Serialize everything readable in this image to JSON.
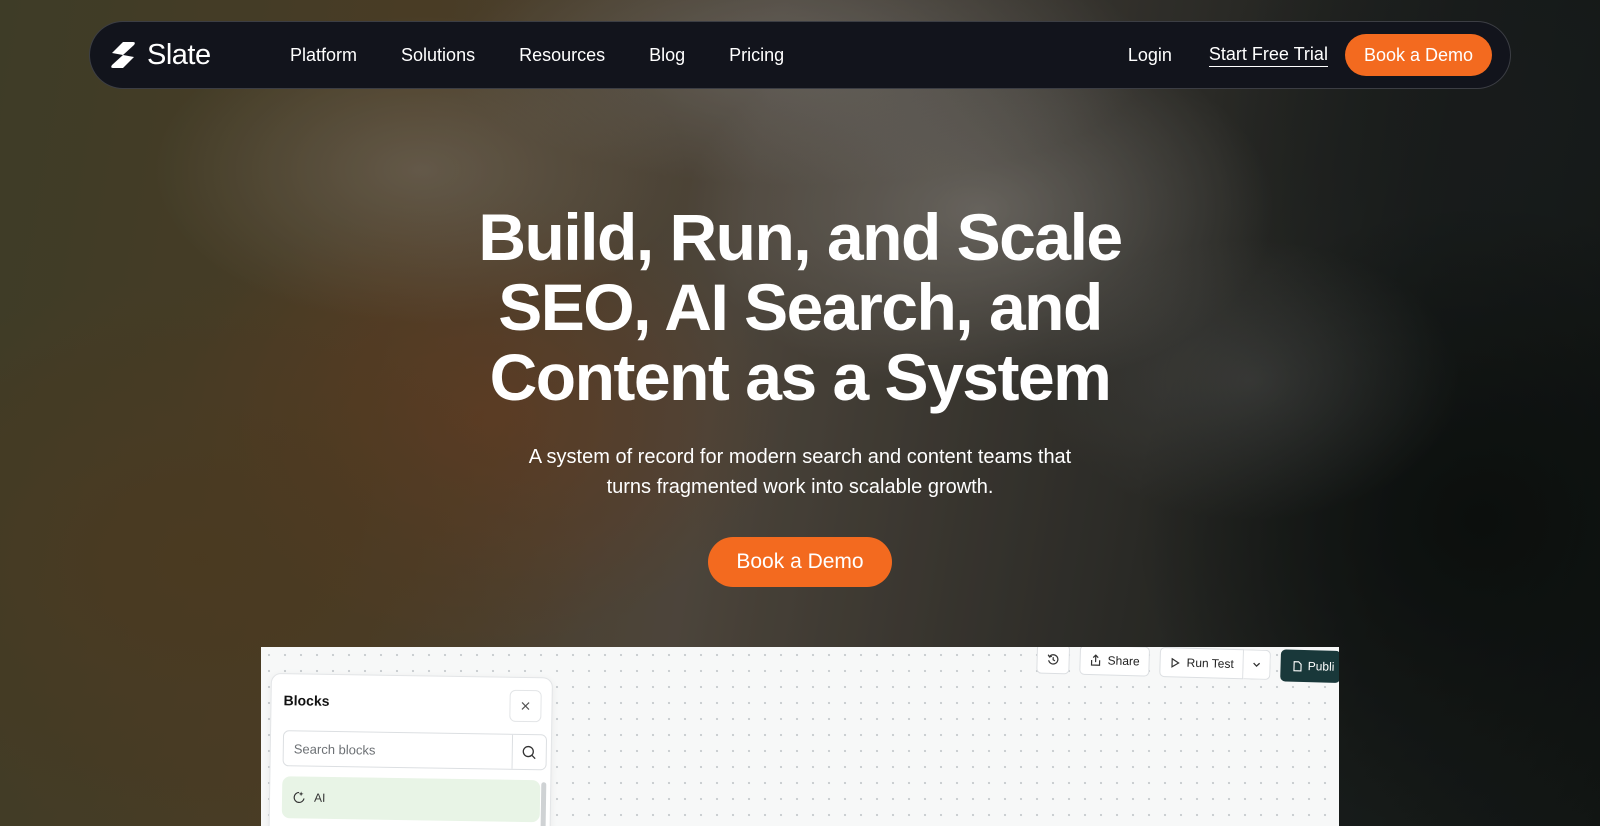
{
  "nav": {
    "logo_text": "Slate",
    "links": [
      "Platform",
      "Solutions",
      "Resources",
      "Blog",
      "Pricing"
    ],
    "login": "Login",
    "trial": "Start Free Trial",
    "demo": "Book a Demo"
  },
  "hero": {
    "title_lines": [
      "Build, Run, and Scale",
      "SEO, AI Search, and",
      "Content as a System"
    ],
    "subtitle_lines": [
      "A system of record for modern search and content teams that",
      "turns fragmented work into scalable growth."
    ],
    "cta": "Book a Demo"
  },
  "app": {
    "toolbar": {
      "share": "Share",
      "run_test": "Run Test",
      "publish": "Publi"
    },
    "blocks": {
      "title": "Blocks",
      "search_placeholder": "Search blocks",
      "items": [
        "AI"
      ]
    }
  },
  "colors": {
    "accent": "#f36a1f",
    "nav_bg": "#12141c",
    "publish_bg": "#19383a",
    "ai_item_bg": "#e8f4e6"
  },
  "icons": [
    "slate-logo-icon",
    "history-icon",
    "share-icon",
    "play-icon",
    "chevron-down-icon",
    "file-icon",
    "close-icon",
    "search-icon",
    "ai-icon"
  ]
}
